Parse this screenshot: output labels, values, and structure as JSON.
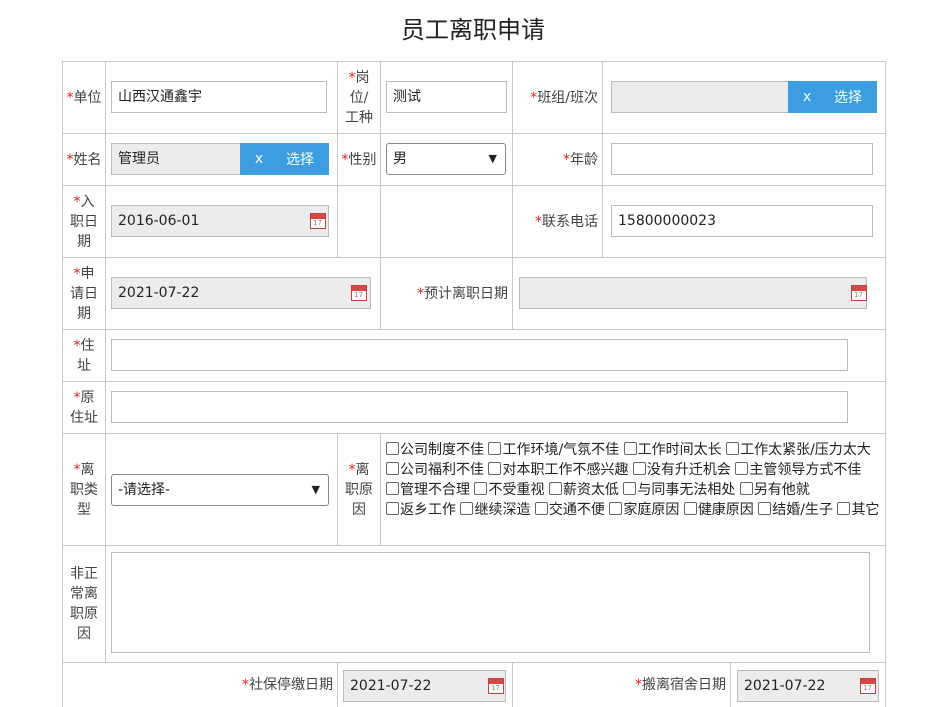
{
  "page": {
    "title": "员工离职申请"
  },
  "fields": {
    "unit": {
      "label": "单位",
      "value": "山西汉通鑫宇"
    },
    "position": {
      "label_lines": [
        "岗",
        "位/",
        "工种"
      ],
      "value": "测试"
    },
    "team": {
      "label": "班组/班次",
      "value": ""
    },
    "name": {
      "label": "姓名",
      "value": "管理员"
    },
    "gender": {
      "label": "性别",
      "value": "男"
    },
    "age": {
      "label": "年龄",
      "value": ""
    },
    "entry_date": {
      "label_lines": [
        "入",
        "职日",
        "期"
      ],
      "value": "2016-06-01"
    },
    "phone": {
      "label": "联系电话",
      "value": "15800000023"
    },
    "apply_date": {
      "label_lines": [
        "申",
        "请日",
        "期"
      ],
      "value": "2021-07-22"
    },
    "expected_leave_date": {
      "label": "预计离职日期",
      "value": ""
    },
    "address": {
      "label": "住址",
      "value": ""
    },
    "former_address": {
      "label_lines": [
        "原",
        "住址"
      ],
      "value": ""
    },
    "leave_type": {
      "label_lines": [
        "离",
        "职类",
        "型"
      ],
      "value": "-请选择-"
    },
    "leave_reason": {
      "label_lines": [
        "离",
        "职原",
        "因"
      ]
    },
    "abnormal_reason": {
      "label_lines": [
        "非正",
        "常离",
        "职原",
        "因"
      ],
      "value": ""
    },
    "social_stop_date": {
      "label": "社保停缴日期",
      "value": "2021-07-22"
    },
    "dorm_leave_date": {
      "label": "搬离宿舍日期",
      "value": "2021-07-22"
    }
  },
  "buttons": {
    "clear": "x",
    "choose": "选择"
  },
  "calendar_icon_text": "17",
  "reasons": [
    "公司制度不佳",
    "工作环境/气氛不佳",
    "工作时间太长",
    "工作太紧张/压力太大",
    "公司福利不佳",
    "对本职工作不感兴趣",
    "没有升迁机会",
    "主管领导方式不佳",
    "管理不合理",
    "不受重视",
    "薪资太低",
    "与同事无法相处",
    "另有他就",
    "返乡工作",
    "继续深造",
    "交通不便",
    "家庭原因",
    "健康原因",
    "结婚/生子",
    "其它"
  ],
  "colors": {
    "button_blue": "#3a9ee0",
    "required_red": "#e02020",
    "disabled_gray": "#ececec"
  }
}
